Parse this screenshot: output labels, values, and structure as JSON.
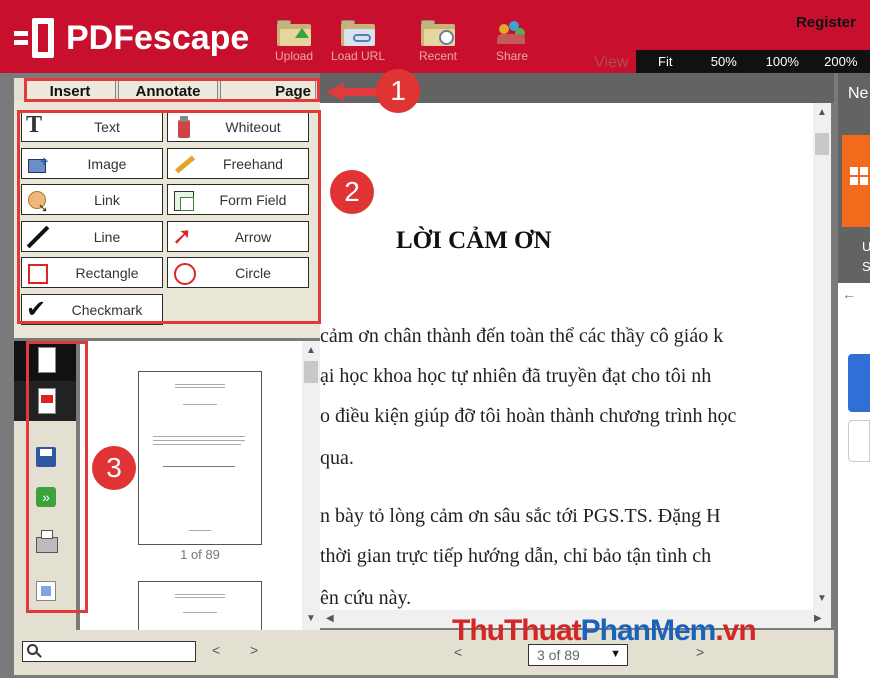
{
  "header": {
    "logo_text": "PDFescape",
    "register": "Register",
    "view_label": "View",
    "tools": [
      {
        "label": "Upload",
        "icon": "upload-folder-icon"
      },
      {
        "label": "Load URL",
        "icon": "load-url-folder-icon"
      },
      {
        "label": "Recent",
        "icon": "recent-folder-icon"
      },
      {
        "label": "Share",
        "icon": "share-people-icon"
      }
    ],
    "zoom": [
      "Fit",
      "50%",
      "100%",
      "200%"
    ]
  },
  "tabs": [
    "Insert",
    "Annotate",
    "Page"
  ],
  "insert_tools": [
    {
      "label": "Text",
      "icon": "text-tool-icon"
    },
    {
      "label": "Whiteout",
      "icon": "whiteout-icon"
    },
    {
      "label": "Image",
      "icon": "image-tool-icon"
    },
    {
      "label": "Freehand",
      "icon": "freehand-pencil-icon"
    },
    {
      "label": "Link",
      "icon": "link-tool-icon"
    },
    {
      "label": "Form Field",
      "icon": "form-field-icon"
    },
    {
      "label": "Line",
      "icon": "line-tool-icon"
    },
    {
      "label": "Arrow",
      "icon": "arrow-tool-icon"
    },
    {
      "label": "Rectangle",
      "icon": "rectangle-tool-icon"
    },
    {
      "label": "Circle",
      "icon": "circle-tool-icon"
    },
    {
      "label": "Checkmark",
      "icon": "checkmark-tool-icon"
    }
  ],
  "document": {
    "title": "LỜI CẢM ƠN",
    "lines": [
      "cảm ơn chân thành đến toàn thể các thầy cô giáo k",
      "ại học khoa học tự nhiên đã truyền đạt cho tôi nh",
      "o điều kiện giúp đỡ tôi hoàn thành chương trình học",
      "qua.",
      "n bày tỏ lòng cảm ơn sâu sắc tới PGS.TS. Đặng H",
      "thời gian trực tiếp hướng dẫn, chỉ bảo tận tình ch",
      "ên cứu này."
    ]
  },
  "thumbnail": {
    "caption": "1 of 89"
  },
  "bottom": {
    "page_select": "3 of 89",
    "prev": "<",
    "next": ">"
  },
  "annotations": {
    "badge1": "1",
    "badge2": "2",
    "badge3": "3",
    "box_color": "#e23a3a"
  },
  "watermark": {
    "part1": "ThuThuat",
    "part2": "PhanMem",
    "part3": ".vn"
  },
  "right_panel": {
    "text1": "Ne",
    "text2": "U",
    "text3": "S",
    "arrow": "←"
  },
  "colors": {
    "brand": "#c8102e",
    "panel": "#e4e0d1"
  }
}
